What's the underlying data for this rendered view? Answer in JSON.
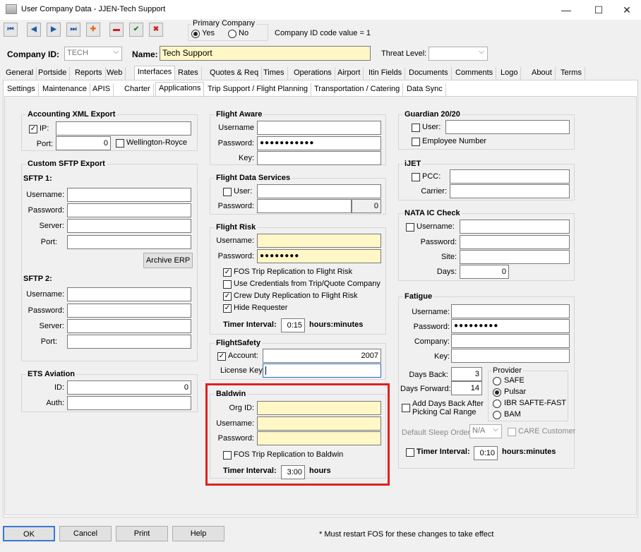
{
  "window": {
    "title": "User Company Data - JJEN-Tech Support",
    "minimize": "—",
    "maximize": "☐",
    "close": "✕"
  },
  "toolbar": {
    "first": "⏮",
    "prev": "◀",
    "next": "▶",
    "last": "⏭",
    "add": "✚",
    "remove": "▬",
    "save": "✔",
    "cancel": "✖"
  },
  "primary_company": {
    "legend": "Primary Company",
    "yes": "Yes",
    "no": "No",
    "id_code_text": "Company ID code value = 1"
  },
  "company": {
    "id_label": "Company ID:",
    "id_value": "TECH",
    "name_label": "Name:",
    "name_value": "Tech Support",
    "threat_label": "Threat Level:",
    "threat_value": ""
  },
  "tabs_main": [
    "General",
    "Portside",
    "Reports",
    "Web",
    "Interfaces",
    "Rates",
    "Quotes & Req",
    "Times",
    "Operations",
    "Airport",
    "Itin Fields",
    "Documents",
    "Comments",
    "Logo",
    "About",
    "Terms"
  ],
  "tabs_sub": [
    "Settings",
    "Maintenance",
    "APIS",
    "Charter",
    "Applications",
    "Trip Support / Flight Planning",
    "Transportation / Catering",
    "Data Sync"
  ],
  "accounting_xml": {
    "legend": "Accounting XML Export",
    "ip_label": "IP:",
    "ip_value": "",
    "port_label": "Port:",
    "port_value": "0",
    "wellington_label": "Wellington-Royce"
  },
  "custom_sftp": {
    "legend": "Custom SFTP Export",
    "sftp1": "SFTP 1:",
    "sftp2": "SFTP 2:",
    "username": "Username:",
    "password": "Password:",
    "server": "Server:",
    "port": "Port:",
    "archive_button": "Archive ERP"
  },
  "ets_aviation": {
    "legend": "ETS Aviation",
    "id_label": "ID:",
    "id_value": "0",
    "auth_label": "Auth:"
  },
  "flight_aware": {
    "legend": "Flight Aware",
    "username": "Username",
    "password": "Password:",
    "password_value": "●●●●●●●●●●●",
    "key": "Key:"
  },
  "flight_data_services": {
    "legend": "Flight Data Services",
    "user": "User:",
    "password": "Password:",
    "password_num": "0"
  },
  "flight_risk": {
    "legend": "Flight Risk",
    "username": "Username:",
    "password": "Password:",
    "password_value": "●●●●●●●●",
    "cb1": "FOS Trip Replication to Flight Risk",
    "cb2": "Use Credentials from Trip/Quote Company",
    "cb3": "Crew Duty Replication to Flight Risk",
    "cb4": "Hide Requester",
    "timer_label": "Timer Interval:",
    "timer_value": "0:15",
    "timer_unit": "hours:minutes"
  },
  "flight_safety": {
    "legend": "FlightSafety",
    "account": "Account:",
    "account_value": "2007",
    "license": "License Key:"
  },
  "baldwin": {
    "legend": "Baldwin",
    "org_id": "Org ID:",
    "username": "Username:",
    "password": "Password:",
    "cb": "FOS Trip Replication to Baldwin",
    "timer_label": "Timer Interval:",
    "timer_value": "3:00",
    "timer_unit": "hours"
  },
  "guardian": {
    "legend": "Guardian 20/20",
    "user": "User:",
    "employee": "Employee Number"
  },
  "ijet": {
    "legend": "iJET",
    "pcc": "PCC:",
    "carrier": "Carrier:"
  },
  "nata": {
    "legend": "NATA IC Check",
    "username": "Username:",
    "password": "Password:",
    "site": "Site:",
    "days": "Days:",
    "days_value": "0"
  },
  "fatigue": {
    "legend": "Fatigue",
    "username": "Username:",
    "password": "Password:",
    "password_value": "●●●●●●●●●",
    "company": "Company:",
    "key": "Key:",
    "days_back": "Days Back:",
    "days_back_value": "3",
    "days_forward": "Days Forward:",
    "days_forward_value": "14",
    "add_days": "Add Days Back After Picking Cal Range",
    "provider_legend": "Provider",
    "providers": [
      "SAFE",
      "Pulsar",
      "IBR SAFTE-FAST",
      "BAM"
    ],
    "sleep_order_label": "Default Sleep Order:",
    "sleep_order_value": "N/A",
    "care_customer": "CARE Customer",
    "timer_label": "Timer Interval:",
    "timer_value": "0:10",
    "timer_unit": "hours:minutes"
  },
  "footer": {
    "ok": "OK",
    "cancel": "Cancel",
    "print": "Print",
    "help": "Help",
    "note": "* Must restart FOS for these changes to take effect"
  },
  "colors": {
    "highlight": "#e02020",
    "required": "#fff7c6"
  }
}
